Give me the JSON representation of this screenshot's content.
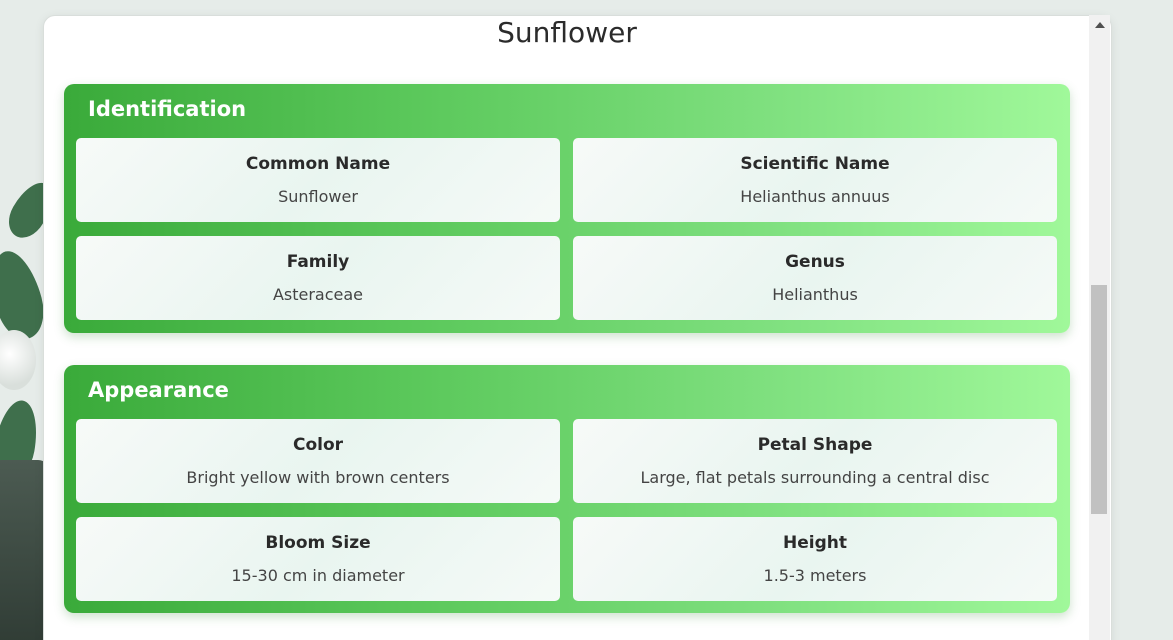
{
  "plant": {
    "name": "Sunflower"
  },
  "sections": {
    "identification": {
      "title": "Identification",
      "cards": [
        {
          "label": "Common Name",
          "value": "Sunflower"
        },
        {
          "label": "Scientific Name",
          "value": "Helianthus annuus"
        },
        {
          "label": "Family",
          "value": "Asteraceae"
        },
        {
          "label": "Genus",
          "value": "Helianthus"
        }
      ]
    },
    "appearance": {
      "title": "Appearance",
      "cards": [
        {
          "label": "Color",
          "value": "Bright yellow with brown centers"
        },
        {
          "label": "Petal Shape",
          "value": "Large, flat petals surrounding a central disc"
        },
        {
          "label": "Bloom Size",
          "value": "15-30 cm in diameter"
        },
        {
          "label": "Height",
          "value": "1.5-3 meters"
        }
      ]
    }
  },
  "colors": {
    "section_gradient_start": "#3aaa3a",
    "section_gradient_end": "#a0f89a",
    "card_background": "#eef7f2",
    "title_text": "#2b2b2b"
  },
  "icons": {
    "scroll_up": "scroll-up-arrow-icon"
  }
}
